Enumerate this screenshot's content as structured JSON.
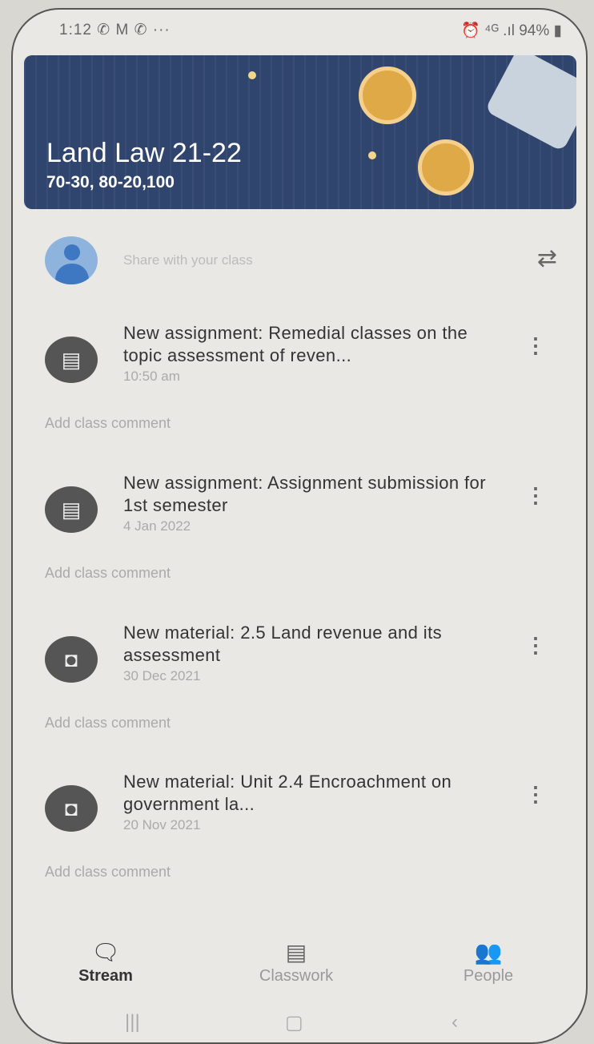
{
  "status_bar": {
    "left": "1:12 ✆ M ✆ ···",
    "right": "⏰ ⁴ᴳ .ıl 94% ▮"
  },
  "header": {
    "title": "Land Law 21-22",
    "subtitle": "70-30, 80-20,100"
  },
  "share": {
    "placeholder": "Share with your class"
  },
  "posts": [
    {
      "title": "New assignment: Remedial classes on the topic assessment of reven...",
      "date": "10:50 am",
      "comment": "Add class comment",
      "icon": "assignment-icon"
    },
    {
      "title": "New assignment: Assignment submission for 1st semester",
      "date": "4 Jan 2022",
      "comment": "Add class comment",
      "icon": "assignment-icon"
    },
    {
      "title": "New material: 2.5 Land revenue and its assessment",
      "date": "30 Dec 2021",
      "comment": "Add class comment",
      "icon": "material-icon"
    },
    {
      "title": "New material: Unit 2.4 Encroachment on government la...",
      "date": "20 Nov 2021",
      "comment": "Add class comment",
      "icon": "material-icon"
    }
  ],
  "nav": {
    "stream": "Stream",
    "classwork": "Classwork",
    "people": "People",
    "active": "stream"
  },
  "colors": {
    "banner": "#2f456e",
    "avatar": "#3f78c2",
    "icon_bg": "#555555"
  }
}
